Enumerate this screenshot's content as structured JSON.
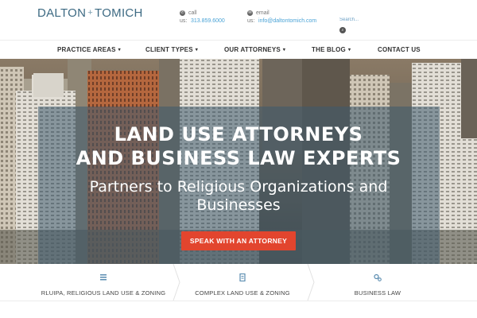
{
  "brand": {
    "name_left": "DALTON",
    "plus": "+",
    "name_right": "TOMICH"
  },
  "contact": {
    "call": {
      "icon": "phone-icon",
      "label": "call",
      "prefix": "us:",
      "value": "313.859.6000"
    },
    "email": {
      "icon": "envelope-icon",
      "label": "email",
      "prefix": "us:",
      "value": "info@daltontomich.com"
    }
  },
  "search": {
    "placeholder": "Search...",
    "button_icon": "search-icon"
  },
  "nav": {
    "items": [
      {
        "label": "PRACTICE AREAS",
        "has_dropdown": true
      },
      {
        "label": "CLIENT TYPES",
        "has_dropdown": true
      },
      {
        "label": "OUR ATTORNEYS",
        "has_dropdown": true
      },
      {
        "label": "THE BLOG",
        "has_dropdown": true
      },
      {
        "label": "CONTACT US",
        "has_dropdown": false
      }
    ],
    "caret": "▾"
  },
  "hero": {
    "headline_line1": "LAND USE ATTORNEYS",
    "headline_line2": "AND BUSINESS LAW EXPERTS",
    "subhead_line1": "Partners to Religious Organizations and",
    "subhead_line2": "Businesses",
    "cta_label": "SPEAK WITH AN ATTORNEY"
  },
  "services": [
    {
      "icon": "lines-icon",
      "label": "RLUIPA, RELIGIOUS LAND USE & ZONING"
    },
    {
      "icon": "document-icon",
      "label": "COMPLEX LAND USE & ZONING"
    },
    {
      "icon": "gears-icon",
      "label": "BUSINESS LAW"
    }
  ],
  "colors": {
    "brand": "#3d6a83",
    "link": "#4aa3d6",
    "cta": "#e2452e",
    "overlay": "#3c5a6e"
  }
}
